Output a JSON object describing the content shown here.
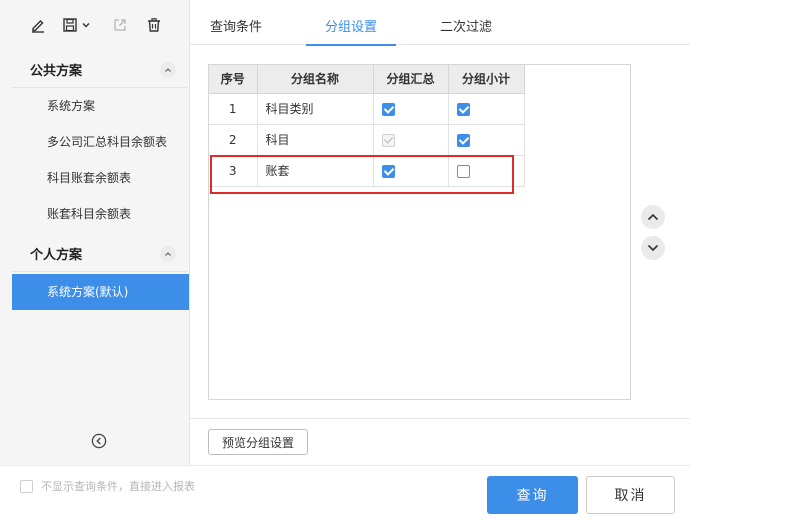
{
  "toolbar": {
    "icons": [
      "edit-icon",
      "save-icon",
      "dropdown-caret-icon",
      "export-icon",
      "delete-icon"
    ]
  },
  "sidebar": {
    "public_section": {
      "title": "公共方案",
      "collapse_icon": "chevron-up-icon"
    },
    "public_items": [
      {
        "label": "系统方案"
      },
      {
        "label": "多公司汇总科目余额表"
      },
      {
        "label": "科目账套余额表"
      },
      {
        "label": "账套科目余额表"
      }
    ],
    "personal_section": {
      "title": "个人方案",
      "collapse_icon": "chevron-up-icon"
    },
    "personal_items": [
      {
        "label": "系统方案(默认)",
        "active": true
      }
    ],
    "collapse_sidebar_icon": "circle-chevron-left-icon"
  },
  "tabs": [
    {
      "label": "查询条件",
      "active": false
    },
    {
      "label": "分组设置",
      "active": true
    },
    {
      "label": "二次过滤",
      "active": false
    }
  ],
  "grid": {
    "headers": {
      "seq": "序号",
      "name": "分组名称",
      "sum": "分组汇总",
      "subtotal": "分组小计"
    },
    "rows": [
      {
        "seq": "1",
        "name": "科目类别",
        "sum": "checked",
        "subtotal": "checked"
      },
      {
        "seq": "2",
        "name": "科目",
        "sum": "checked-disabled",
        "subtotal": "checked"
      },
      {
        "seq": "3",
        "name": "账套",
        "sum": "checked",
        "subtotal": "unchecked"
      }
    ],
    "highlighted_row": "3"
  },
  "move": {
    "up_icon": "chevron-up-icon",
    "down_icon": "chevron-down-icon"
  },
  "preview_button": "预览分组设置",
  "skip_option": {
    "label": "不显示查询条件，直接进入报表",
    "checked": false
  },
  "actions": {
    "query": "查询",
    "cancel": "取消"
  },
  "colors": {
    "accent": "#3d8ee8",
    "highlight": "#e02a2a",
    "sidebar_bg": "#f5f5f5"
  }
}
